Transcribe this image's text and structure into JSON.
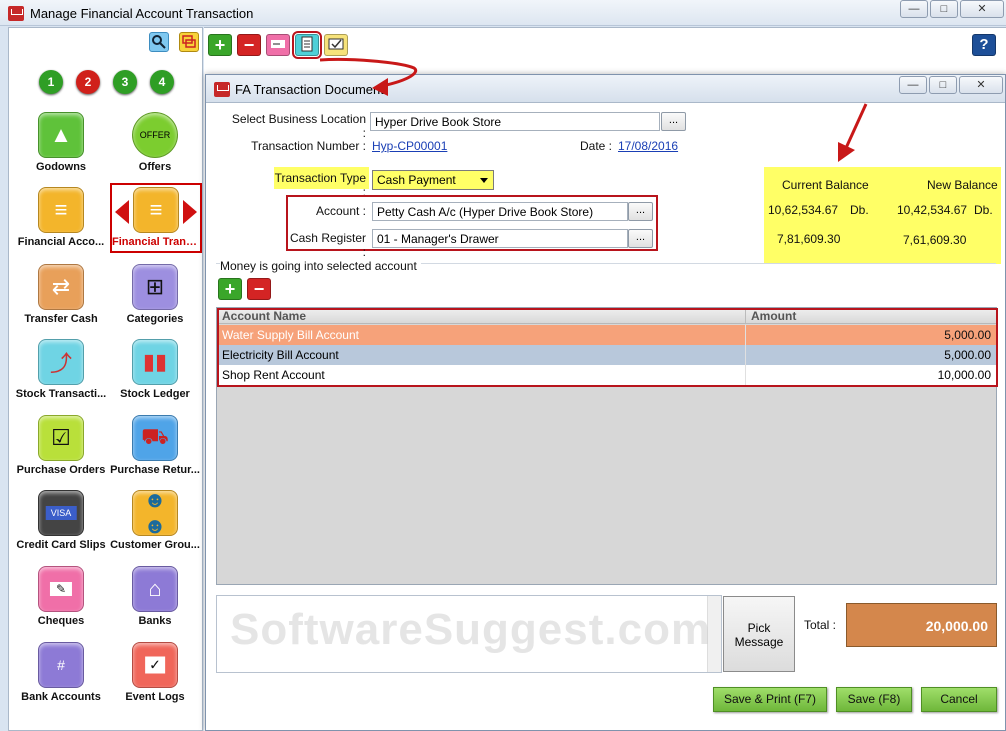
{
  "outer_window": {
    "title": "Manage Financial Account Transaction",
    "min": "—",
    "max": "□",
    "close": "✕"
  },
  "sidebar": {
    "numbers": [
      "1",
      "2",
      "3",
      "4"
    ],
    "tiles": [
      {
        "label": "Godowns",
        "icon": "warehouse-icon",
        "color": "#5fc23a"
      },
      {
        "label": "Offers",
        "icon": "offer-tag-icon",
        "color": "#7ccd2f"
      },
      {
        "label": "Financial Acco...",
        "icon": "coin-stack-icon",
        "color": "#f3b52b"
      },
      {
        "label": "Financial Trans...",
        "icon": "coin-transfer-icon",
        "color": "#f3b52b"
      },
      {
        "label": "Transfer Cash",
        "icon": "cash-transfer-icon",
        "color": "#e8a05a"
      },
      {
        "label": "Categories",
        "icon": "hierarchy-icon",
        "color": "#9d8fe0"
      },
      {
        "label": "Stock Transacti...",
        "icon": "stock-transfer-icon",
        "color": "#6fd4e4"
      },
      {
        "label": "Stock Ledger",
        "icon": "bar-chart-icon",
        "color": "#6fd4e4"
      },
      {
        "label": "Purchase Orders",
        "icon": "checklist-icon",
        "color": "#b9e03a"
      },
      {
        "label": "Purchase Retur...",
        "icon": "truck-return-icon",
        "color": "#4fa4e8"
      },
      {
        "label": "Credit Card Slips",
        "icon": "credit-card-icon",
        "color": "#444444"
      },
      {
        "label": "Customer Grou...",
        "icon": "customer-group-icon",
        "color": "#f3b52b"
      },
      {
        "label": "Cheques",
        "icon": "cheque-icon",
        "color": "#f06fa8"
      },
      {
        "label": "Banks",
        "icon": "bank-icon",
        "color": "#8d7ad6"
      },
      {
        "label": "Bank Accounts",
        "icon": "bank-account-icon",
        "color": "#8d7ad6"
      },
      {
        "label": "Event Logs",
        "icon": "calendar-check-icon",
        "color": "#f0665a"
      }
    ]
  },
  "toolbar": {
    "add": "+",
    "remove": "−",
    "help": "?"
  },
  "dialog": {
    "title": "FA Transaction Document",
    "min": "—",
    "max": "□",
    "close": "✕",
    "location_label": "Select Business Location :",
    "location_value": "Hyper Drive Book Store",
    "txn_number_label": "Transaction Number :",
    "txn_number_value": "Hyp-CP00001",
    "date_label": "Date :",
    "date_value": "17/08/2016",
    "txn_type_label": "Transaction Type :",
    "txn_type_value": "Cash Payment",
    "account_label": "Account :",
    "account_value": "Petty Cash A/c (Hyper Drive Book Store)",
    "cash_register_label": "Cash Register :",
    "cash_register_value": "01 - Manager's Drawer",
    "ellipsis": "...",
    "balance": {
      "current_header": "Current Balance",
      "new_header": "New Balance",
      "current_1": "10,62,534.67",
      "current_1_suffix": "Db.",
      "new_1": "10,42,534.67",
      "new_1_suffix": "Db.",
      "current_2": "7,81,609.30",
      "new_2": "7,61,609.30"
    },
    "money_caption": "Money is going into selected account",
    "grid": {
      "headers": [
        "Account Name",
        "Amount"
      ],
      "rows": [
        {
          "name": "Water Supply Bill Account",
          "amount": "5,000.00"
        },
        {
          "name": "Electricity Bill Account",
          "amount": "5,000.00"
        },
        {
          "name": "Shop Rent Account",
          "amount": "10,000.00"
        }
      ]
    },
    "pick_message": "Pick Message",
    "total_label": "Total :",
    "total_value": "20,000.00",
    "buttons": {
      "save_print": "Save & Print (F7)",
      "save": "Save (F8)",
      "cancel": "Cancel"
    },
    "watermark": "SoftwareSuggest.com"
  },
  "colors": {
    "selected_row": "#f6a27a",
    "alt_row": "#b8c8db",
    "highlight": "#ffff66",
    "annotation_red": "#b8141c"
  }
}
